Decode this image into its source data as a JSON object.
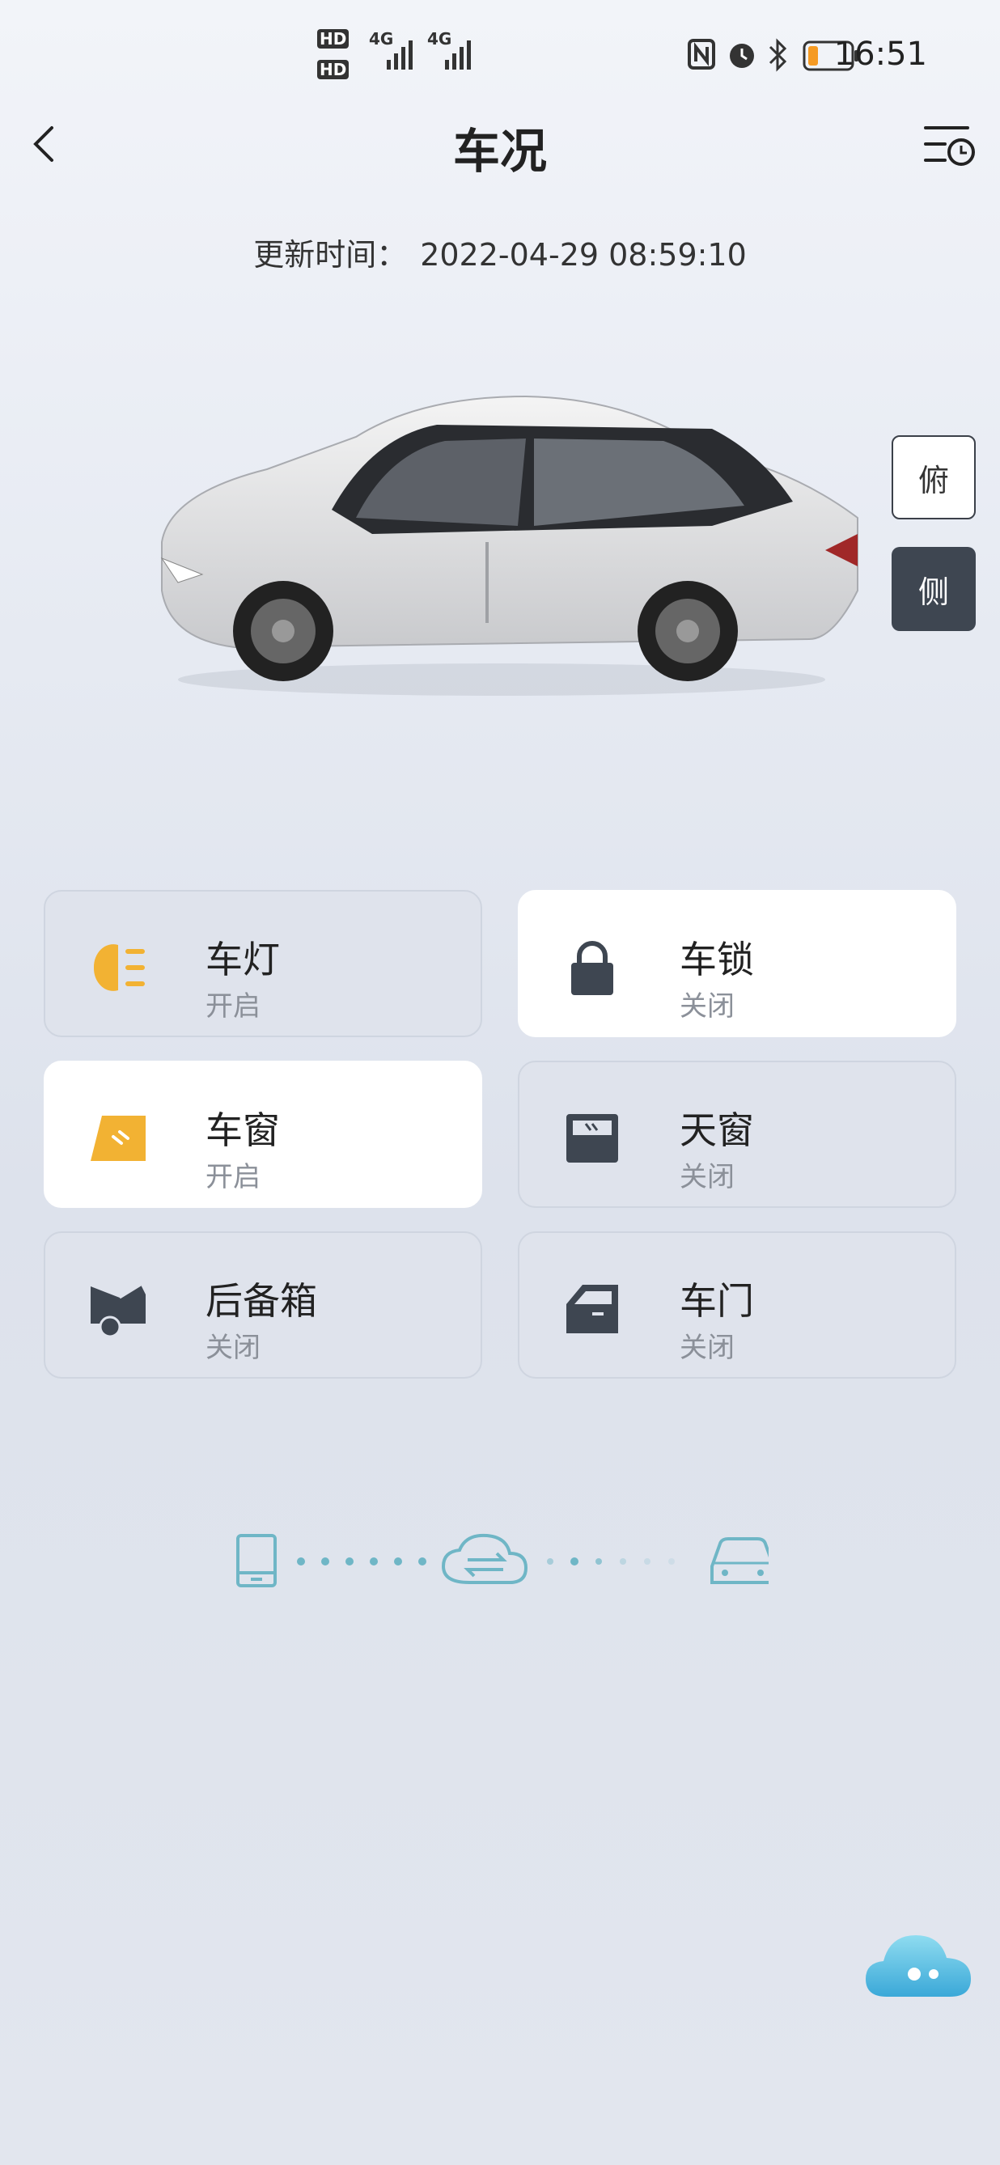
{
  "status_bar": {
    "time": "16:51",
    "sim1": "HD",
    "sim2": "HD",
    "net1": "4G",
    "net2": "4G"
  },
  "header": {
    "title": "车况",
    "back_icon": "chevron-left-icon",
    "history_icon": "history-list-icon"
  },
  "update": {
    "label": "更新时间：",
    "value": "2022-04-29 08:59:10"
  },
  "view_toggle": {
    "top_label": "俯",
    "side_label": "侧",
    "selected": "侧"
  },
  "cards": [
    {
      "name": "车灯",
      "state": "开启",
      "icon": "headlight-icon",
      "active": false
    },
    {
      "name": "车锁",
      "state": "关闭",
      "icon": "lock-icon",
      "active": true
    },
    {
      "name": "车窗",
      "state": "开启",
      "icon": "window-icon",
      "active": true
    },
    {
      "name": "天窗",
      "state": "关闭",
      "icon": "sunroof-icon",
      "active": false
    },
    {
      "name": "后备箱",
      "state": "关闭",
      "icon": "trunk-icon",
      "active": false
    },
    {
      "name": "车门",
      "state": "关闭",
      "icon": "door-icon",
      "active": false
    }
  ],
  "connection": {
    "left_icon": "phone-icon",
    "middle_icon": "cloud-sync-icon",
    "right_icon": "car-icon"
  },
  "colors": {
    "accent": "#f2b233",
    "dark_icon": "#3e4651",
    "teal": "#6fb6c6"
  }
}
